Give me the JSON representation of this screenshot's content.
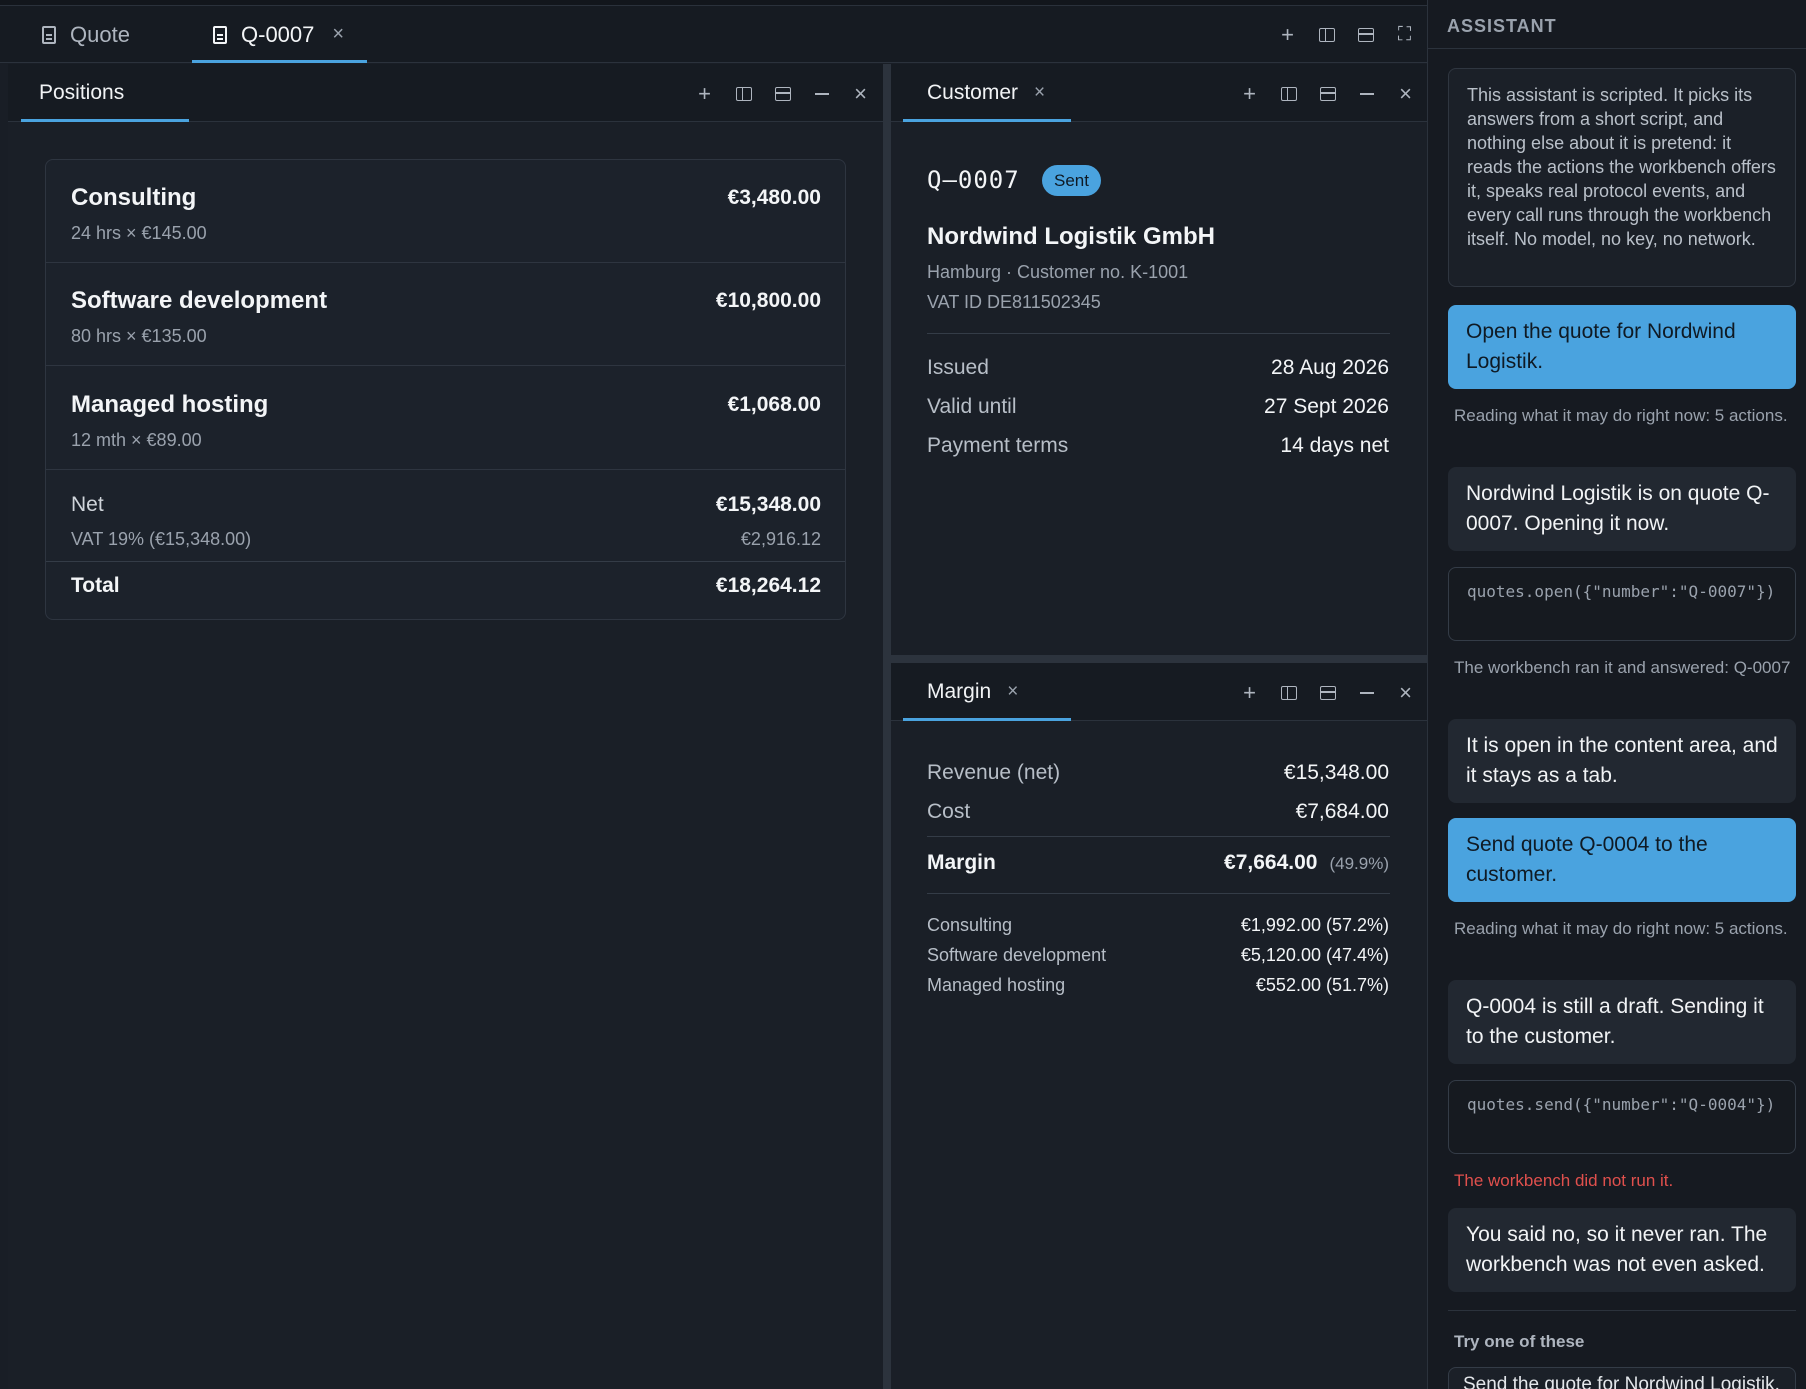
{
  "doc_tabs": [
    {
      "label": "Quote"
    },
    {
      "label": "Q-0007",
      "close": "×"
    }
  ],
  "positions_panel": {
    "tab": "Positions",
    "items": [
      {
        "title": "Consulting",
        "detail": "24 hrs × €145.00",
        "amount": "€3,480.00"
      },
      {
        "title": "Software development",
        "detail": "80 hrs × €135.00",
        "amount": "€10,800.00"
      },
      {
        "title": "Managed hosting",
        "detail": "12 mth × €89.00",
        "amount": "€1,068.00"
      }
    ],
    "net_label": "Net",
    "net_value": "€15,348.00",
    "vat_label": "VAT 19% (€15,348.00)",
    "vat_value": "€2,916.12",
    "total_label": "Total",
    "total_value": "€18,264.12"
  },
  "customer_panel": {
    "tab": "Customer",
    "close": "×",
    "quote_number": "Q–0007",
    "status": "Sent",
    "name": "Nordwind Logistik GmbH",
    "line1": "Hamburg · Customer no. K-1001",
    "line2": "VAT ID DE811502345",
    "fields": [
      {
        "label": "Issued",
        "value": "28 Aug 2026"
      },
      {
        "label": "Valid until",
        "value": "27 Sept 2026"
      },
      {
        "label": "Payment terms",
        "value": "14 days net"
      }
    ]
  },
  "margin_panel": {
    "tab": "Margin",
    "close": "×",
    "revenue_label": "Revenue (net)",
    "revenue_value": "€15,348.00",
    "cost_label": "Cost",
    "cost_value": "€7,684.00",
    "margin_label": "Margin",
    "margin_value": "€7,664.00",
    "margin_pct": "(49.9%)",
    "breakdown": [
      {
        "label": "Consulting",
        "value": "€1,992.00 (57.2%)"
      },
      {
        "label": "Software development",
        "value": "€5,120.00 (47.4%)"
      },
      {
        "label": "Managed hosting",
        "value": "€552.00 (51.7%)"
      }
    ]
  },
  "assistant": {
    "header": "ASSISTANT",
    "note": "This assistant is scripted. It picks its answers from a short script, and nothing else about it is pretend: it reads the actions the workbench offers it, speaks real protocol events, and every call runs through the workbench itself. No model, no key, no network.",
    "user1": "Open the quote for Nordwind Logistik.",
    "meta1": "Reading what it may do right now: 5 actions.",
    "bot1": "Nordwind Logistik is on quote Q-0007. Opening it now.",
    "code1": "quotes.open({\"number\":\"Q-0007\"})",
    "meta2": "The workbench ran it and answered: Q-0007",
    "bot2": "It is open in the content area, and it stays as a tab.",
    "user2": "Send quote Q-0004 to the customer.",
    "meta3": "Reading what it may do right now: 5 actions.",
    "bot3": "Q-0004 is still a draft. Sending it to the customer.",
    "code2": "quotes.send({\"number\":\"Q-0004\"})",
    "error": "The workbench did not run it.",
    "bot4": "You said no, so it never ran. The workbench was not even asked.",
    "suggest_label": "Try one of these",
    "suggest_first": "Send the quote for Nordwind Logistik."
  },
  "icons": {
    "plus": "+",
    "close": "×",
    "expand": "⛶"
  },
  "colors": {
    "accent": "#4aa3df",
    "error": "#e0504d",
    "background": "#191e26"
  }
}
